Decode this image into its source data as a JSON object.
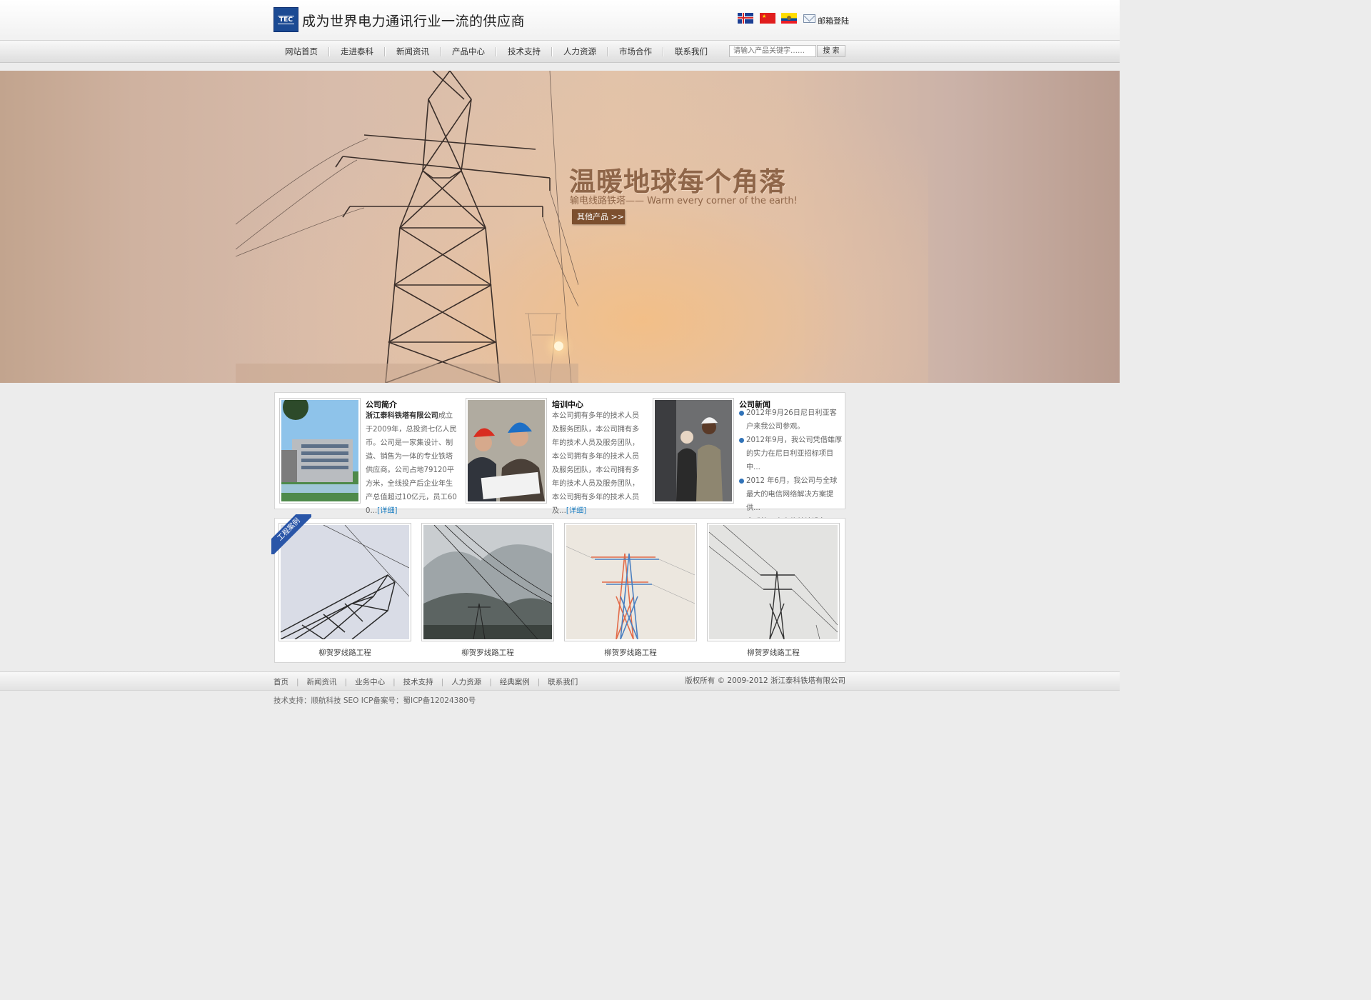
{
  "header": {
    "logo_text": "TEC",
    "slogan": "成为世界电力通讯行业一流的供应商",
    "mail_login": "邮箱登陆"
  },
  "nav": {
    "items": [
      "网站首页",
      "走进泰科",
      "新闻资讯",
      "产品中心",
      "技术支持",
      "人力资源",
      "市场合作",
      "联系我们"
    ],
    "search_placeholder": "请输入产品关键字……",
    "search_button": "搜 索"
  },
  "banner": {
    "title": "温暖地球每个角落",
    "subtitle": "输电线路铁塔—— Warm every corner of the earth!",
    "button": "其他产品 >>"
  },
  "about": {
    "title": "公司简介",
    "company": "浙江泰科铁塔有限公司",
    "text": "成立于2009年，总投资七亿人民币。公司是一家集设计、制造、销售为一体的专业铁塔供应商。公司占地79120平方米，全线投产后企业年生产总值超过10亿元，员工600...",
    "more": "[详细]"
  },
  "training": {
    "title": "培训中心",
    "text": "本公司拥有多年的技术人员及服务团队，本公司拥有多年的技术人员及服务团队，本公司拥有多年的技术人员及服务团队，本公司拥有多年的技术人员及服务团队，本公司拥有多年的技术人员及...",
    "more": "[详细]"
  },
  "news": {
    "title": "公司新闻",
    "items": [
      "2012年9月26日尼日利亚客户来我公司参观。",
      "2012年9月，我公司凭借雄厚的实力在尼日利亚招标项目中...",
      "2012 年6月，我公司与全球最大的电信网络解决方案提供...",
      "全球第二大电信基站设备"
    ]
  },
  "cases": {
    "ribbon": "工程案例",
    "items": [
      {
        "label": "柳贺罗线路工程"
      },
      {
        "label": "柳贺罗线路工程"
      },
      {
        "label": "柳贺罗线路工程"
      },
      {
        "label": "柳贺罗线路工程"
      }
    ]
  },
  "footer": {
    "links": [
      "首页",
      "新闻资讯",
      "业务中心",
      "技术支持",
      "人力资源",
      "经典案例",
      "联系我们"
    ],
    "separator": "|",
    "copyright": "版权所有 © 2009-2012 浙江泰科铁塔有限公司",
    "tech": "技术支持：顺航科技 SEO  ICP备案号：蜀ICP备12024380号"
  },
  "colors": {
    "brand_blue": "#1b4a93",
    "banner_text": "#8f6649",
    "button_brown": "#7c4f2e",
    "link_blue": "#1b7ec2"
  }
}
